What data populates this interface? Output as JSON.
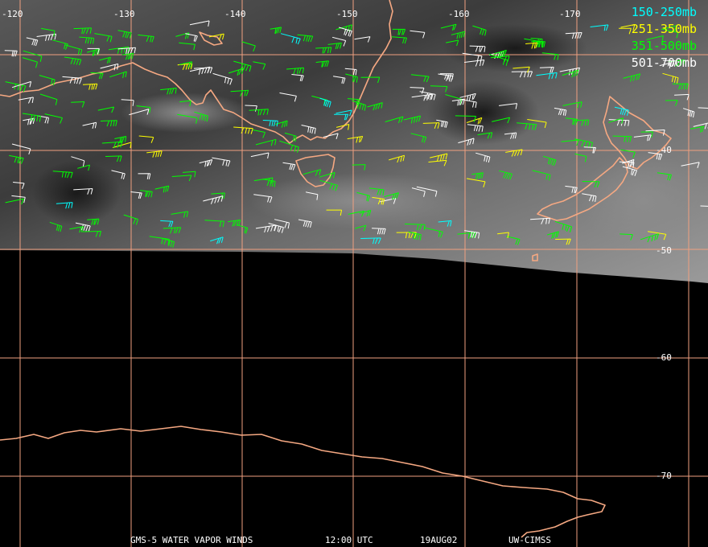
{
  "map": {
    "longitude_labels": [
      "-120",
      "-130",
      "-140",
      "-150",
      "-160",
      "-170"
    ],
    "latitude_labels": [
      "-40",
      "-50",
      "-60",
      "-70"
    ],
    "grid_color": "#f0a080",
    "coast_color": "#f5a882"
  },
  "legend": [
    {
      "label": "150-250mb",
      "color": "#00ffff"
    },
    {
      "label": "251-350mb",
      "color": "#ffff00"
    },
    {
      "label": "351-500mb",
      "color": "#00ff00"
    },
    {
      "label": "501-700mb",
      "color": "#ffffff"
    }
  ],
  "footer": {
    "satellite": "GMS-5 WATER VAPOR WINDS",
    "time": "12:00 UTC",
    "date": "19AUG02",
    "source": "UW-CIMSS"
  }
}
